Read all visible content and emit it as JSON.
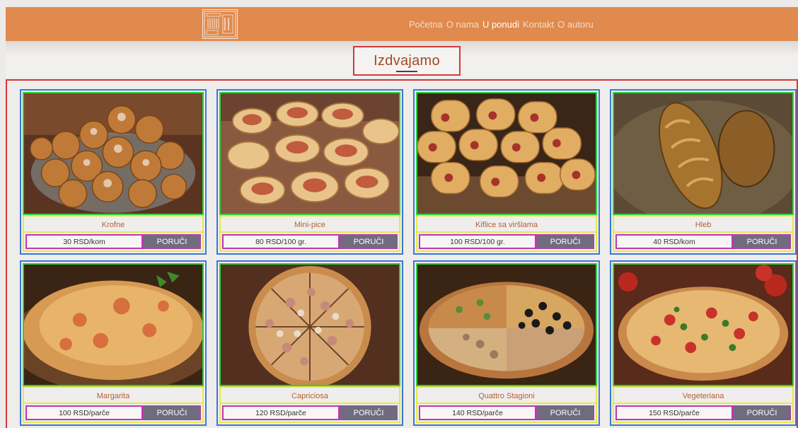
{
  "header": {
    "logo_name": "bakery-logo",
    "nav": [
      {
        "label": "Početna",
        "active": false
      },
      {
        "label": "O nama",
        "active": false
      },
      {
        "label": "U ponudi",
        "active": true
      },
      {
        "label": "Kontakt",
        "active": false
      },
      {
        "label": "O autoru",
        "active": false
      }
    ]
  },
  "section": {
    "title": "Izdvajamo"
  },
  "products": [
    {
      "name": "Krofne",
      "price": "30 RSD/kom",
      "button": "PORUČI",
      "image": "donuts-image"
    },
    {
      "name": "Mini-pice",
      "price": "80 RSD/100 gr.",
      "button": "PORUČI",
      "image": "mini-pizza-image"
    },
    {
      "name": "Kiflice sa viršlama",
      "price": "100 RSD/100 gr.",
      "button": "PORUČI",
      "image": "sausage-rolls-image"
    },
    {
      "name": "Hleb",
      "price": "40 RSD/kom",
      "button": "PORUČI",
      "image": "bread-image"
    },
    {
      "name": "Margarita",
      "price": "100 RSD/parče",
      "button": "PORUČI",
      "image": "pizza-margarita-image"
    },
    {
      "name": "Capriciosa",
      "price": "120 RSD/parče",
      "button": "PORUČI",
      "image": "pizza-capriciosa-image"
    },
    {
      "name": "Quattro Stagioni",
      "price": "140 RSD/parče",
      "button": "PORUČI",
      "image": "pizza-quattro-stagioni-image"
    },
    {
      "name": "Vegeteriana",
      "price": "150 RSD/parče",
      "button": "PORUČI",
      "image": "pizza-vegeteriana-image"
    }
  ],
  "colors": {
    "header": "#e08a4e",
    "accent_text": "#b0613a",
    "button": "#6f6c80",
    "outline_red": "#d53838",
    "outline_blue": "#3b78d8",
    "outline_green": "#2fcf3a",
    "outline_yellow": "#e6e84a",
    "outline_magenta": "#c234b4"
  }
}
